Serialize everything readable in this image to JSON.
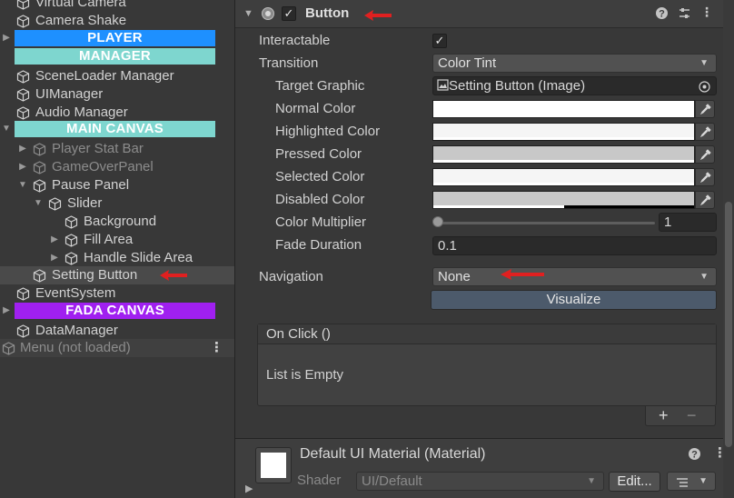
{
  "hierarchy": {
    "rows": [
      {
        "label": "Virtual Camera"
      },
      {
        "label": "Camera Shake"
      },
      {
        "label": "PLAYER",
        "color": "#1e90ff"
      },
      {
        "label": "MANAGER",
        "color": "#7ed6cf"
      },
      {
        "label": "SceneLoader Manager"
      },
      {
        "label": "UIManager"
      },
      {
        "label": "Audio Manager"
      },
      {
        "label": "MAIN CANVAS",
        "color": "#7ed6cf"
      },
      {
        "label": "Player Stat Bar"
      },
      {
        "label": "GameOverPanel"
      },
      {
        "label": "Pause Panel"
      },
      {
        "label": "Slider"
      },
      {
        "label": "Background"
      },
      {
        "label": "Fill Area"
      },
      {
        "label": "Handle Slide Area"
      },
      {
        "label": "Setting Button"
      },
      {
        "label": "EventSystem"
      },
      {
        "label": "FADA CANVAS",
        "color": "#a020f0"
      },
      {
        "label": "DataManager"
      },
      {
        "label": "Menu (not loaded)"
      }
    ]
  },
  "inspector": {
    "component_title": "Button",
    "header_icons": [
      "help-icon",
      "preset-icon",
      "more-icon"
    ],
    "properties": {
      "interactable_label": "Interactable",
      "interactable_value": true,
      "transition_label": "Transition",
      "transition_value": "Color Tint",
      "target_graphic_label": "Target Graphic",
      "target_graphic_value": "Setting Button (Image)",
      "normal_color_label": "Normal Color",
      "highlighted_color_label": "Highlighted Color",
      "pressed_color_label": "Pressed Color",
      "selected_color_label": "Selected Color",
      "disabled_color_label": "Disabled Color",
      "color_multiplier_label": "Color Multiplier",
      "color_multiplier_value": "1",
      "fade_duration_label": "Fade Duration",
      "fade_duration_value": "0.1",
      "navigation_label": "Navigation",
      "navigation_value": "None",
      "visualize_label": "Visualize"
    },
    "colors": {
      "normal": "#ffffff",
      "highlighted": "#f5f5f5",
      "pressed": "#c8c8c8",
      "selected": "#f5f5f5",
      "disabled": "#c8c8c8"
    },
    "on_click": {
      "title": "On Click ()",
      "empty_text": "List is Empty",
      "add_label": "+",
      "remove_label": "−"
    },
    "material": {
      "name": "Default UI Material (Material)",
      "shader_label": "Shader",
      "shader_value": "UI/Default",
      "edit_label": "Edit..."
    }
  }
}
